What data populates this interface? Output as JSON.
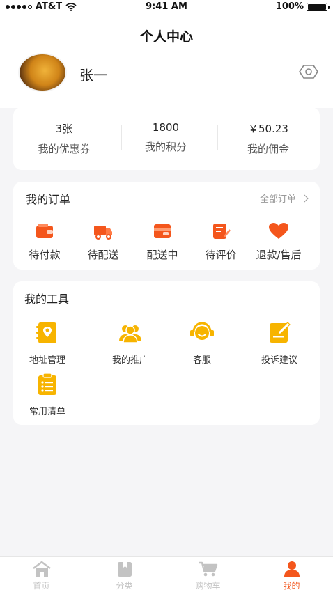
{
  "status_bar": {
    "carrier": "AT&T",
    "time": "9:41 AM",
    "battery": "100%"
  },
  "header": {
    "title": "个人中心",
    "username": "张一"
  },
  "stats": [
    {
      "value": "3张",
      "label": "我的优惠券"
    },
    {
      "value": "1800",
      "label": "我的积分"
    },
    {
      "value": "￥50.23",
      "label": "我的佣金"
    }
  ],
  "orders": {
    "title": "我的订单",
    "all_label": "全部订单",
    "items": [
      {
        "label": "待付款",
        "icon": "wallet-icon"
      },
      {
        "label": "待配送",
        "icon": "truck-icon"
      },
      {
        "label": "配送中",
        "icon": "card-wallet-icon"
      },
      {
        "label": "待评价",
        "icon": "edit-note-icon"
      },
      {
        "label": "退款/售后",
        "icon": "heart-icon"
      }
    ]
  },
  "tools": {
    "title": "我的工具",
    "items": [
      {
        "label": "地址管理",
        "icon": "location-book-icon"
      },
      {
        "label": "我的推广",
        "icon": "users-icon"
      },
      {
        "label": "客服",
        "icon": "headset-icon"
      },
      {
        "label": "投诉建议",
        "icon": "feedback-icon"
      },
      {
        "label": "常用清单",
        "icon": "checklist-icon"
      }
    ]
  },
  "tabbar": [
    {
      "label": "首页",
      "icon": "home-icon"
    },
    {
      "label": "分类",
      "icon": "category-icon"
    },
    {
      "label": "购物车",
      "icon": "cart-icon"
    },
    {
      "label": "我的",
      "icon": "user-icon"
    }
  ],
  "colors": {
    "accent": "#f4561c",
    "tool_yellow": "#f7b400",
    "inactive": "#c3c3c3"
  }
}
